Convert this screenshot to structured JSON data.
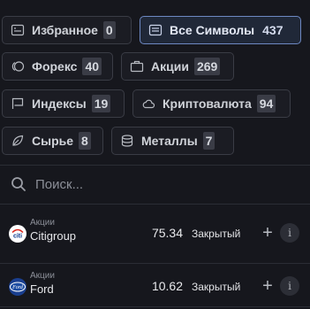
{
  "filters": [
    {
      "label": "Избранное",
      "count": "0",
      "icon": "favorites-list-icon",
      "active": false
    },
    {
      "label": "Все Символы",
      "count": "437",
      "icon": "all-symbols-list-icon",
      "active": true
    },
    {
      "label": "Форекс",
      "count": "40",
      "icon": "forex-coins-icon",
      "active": false
    },
    {
      "label": "Акции",
      "count": "269",
      "icon": "stocks-briefcase-icon",
      "active": false
    },
    {
      "label": "Индексы",
      "count": "19",
      "icon": "indices-flag-icon",
      "active": false
    },
    {
      "label": "Криптовалюта",
      "count": "94",
      "icon": "crypto-cloud-icon",
      "active": false
    },
    {
      "label": "Сырье",
      "count": "8",
      "icon": "commodities-leaf-icon",
      "active": false
    },
    {
      "label": "Металлы",
      "count": "7",
      "icon": "metals-stack-icon",
      "active": false
    }
  ],
  "search": {
    "placeholder": "Поиск..."
  },
  "instruments": [
    {
      "category": "Акции",
      "name": "Citigroup",
      "price": "75.34",
      "status": "Закрытый",
      "logo": "citi-logo",
      "logo_text": "citi"
    },
    {
      "category": "Акции",
      "name": "Ford",
      "price": "10.62",
      "status": "Закрытый",
      "logo": "ford-logo",
      "logo_text": "Ford"
    }
  ],
  "actions": {
    "add": "+",
    "info": "i"
  },
  "colors": {
    "background": "#16171d",
    "active_border": "#6d88c2",
    "chip_border": "#3a3c45"
  }
}
